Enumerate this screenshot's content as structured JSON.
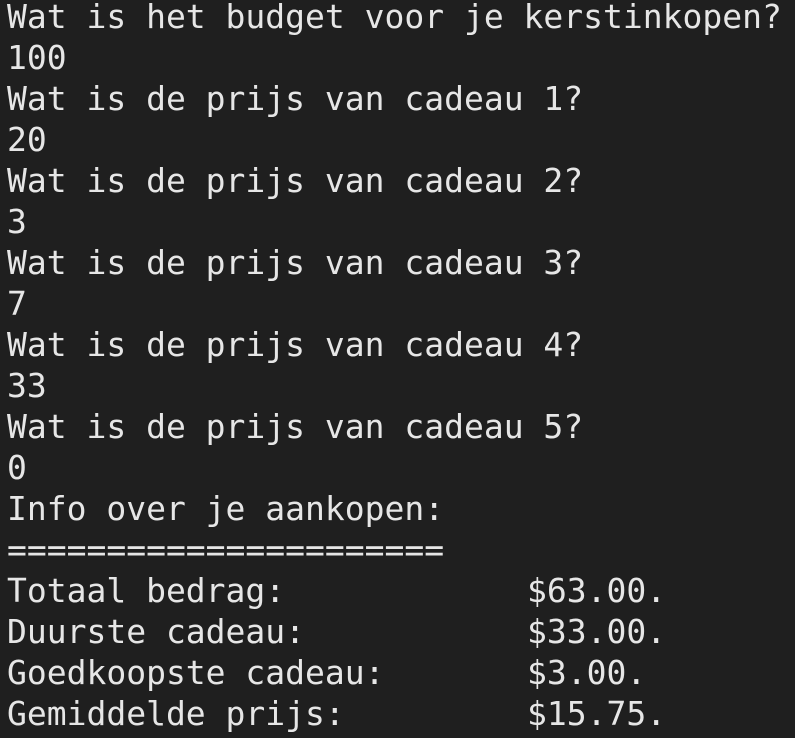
{
  "terminal": {
    "lines": [
      "Wat is het budget voor je kerstinkopen?",
      "100",
      "Wat is de prijs van cadeau 1?",
      "20",
      "Wat is de prijs van cadeau 2?",
      "3",
      "Wat is de prijs van cadeau 3?",
      "7",
      "Wat is de prijs van cadeau 4?",
      "33",
      "Wat is de prijs van cadeau 5?",
      "0",
      "Info over je aankopen:",
      "======================"
    ],
    "summary": [
      {
        "label": "Totaal bedrag:",
        "value": "$63.00."
      },
      {
        "label": "Duurste cadeau:",
        "value": "$33.00."
      },
      {
        "label": "Goedkoopste cadeau:",
        "value": "$3.00."
      },
      {
        "label": "Gemiddelde prijs:",
        "value": "$15.75."
      }
    ]
  }
}
